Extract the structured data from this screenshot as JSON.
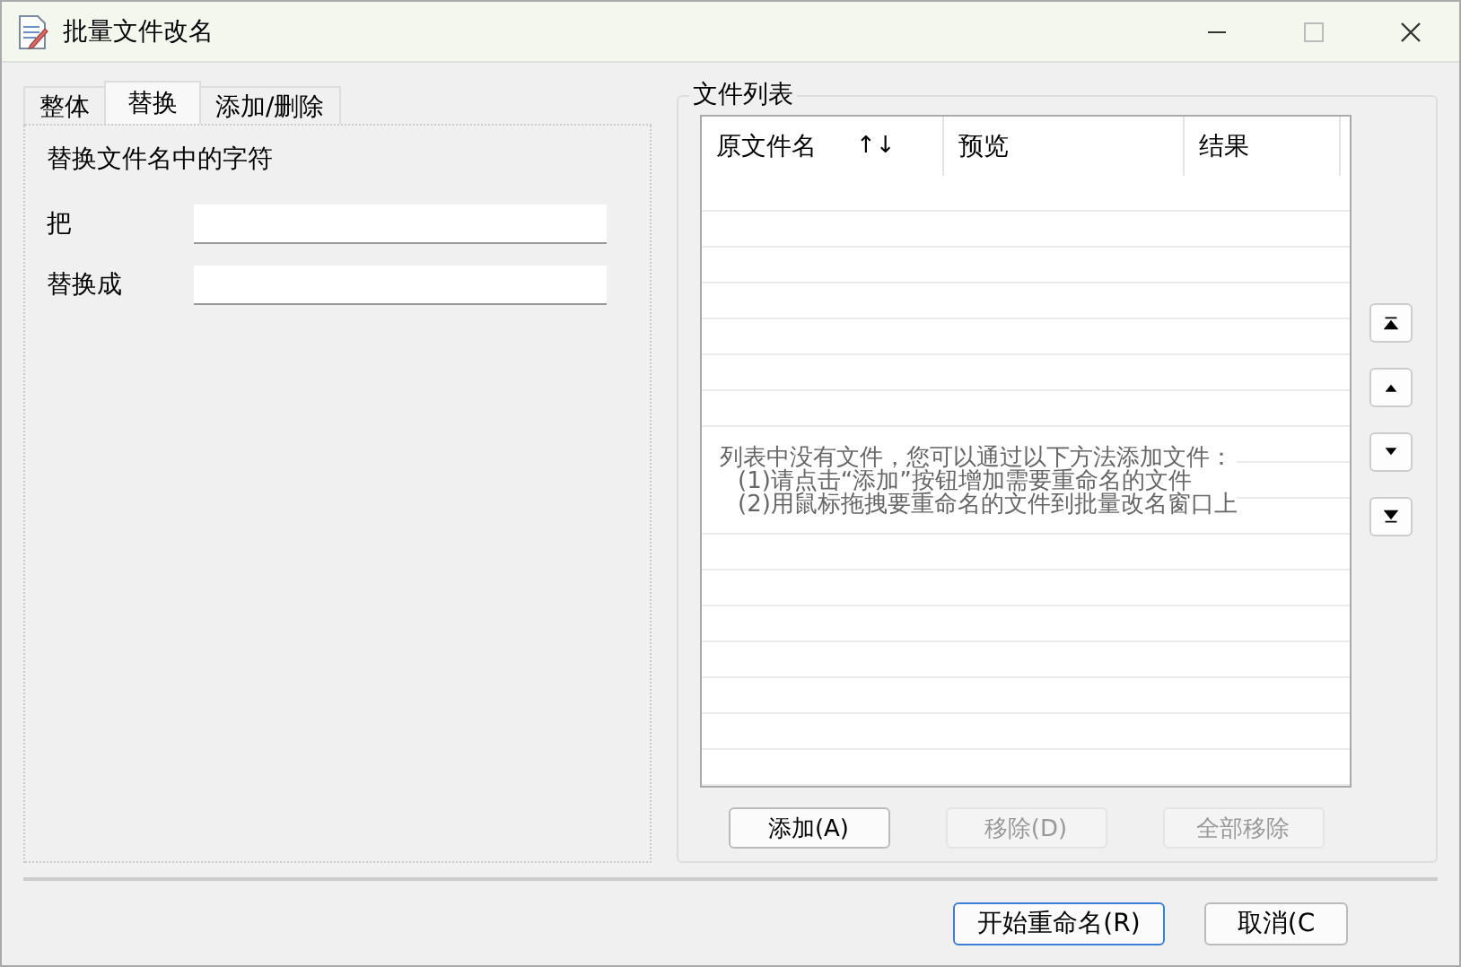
{
  "window": {
    "title": "批量文件改名",
    "maximize_disabled": true
  },
  "tabs": [
    {
      "label": "整体",
      "selected": false
    },
    {
      "label": "替换",
      "selected": true
    },
    {
      "label": "添加/删除",
      "selected": false
    }
  ],
  "replace_panel": {
    "heading": "替换文件名中的字符",
    "fields": [
      {
        "label": "把"
      },
      {
        "label": "替换成"
      }
    ]
  },
  "file_list": {
    "title": "文件列表",
    "columns": [
      {
        "label": "原文件名",
        "sort": "↑↓"
      },
      {
        "label": "预览"
      },
      {
        "label": "结果"
      }
    ],
    "empty_message": [
      "列表中没有文件，您可以通过以下方法添加文件：",
      "(1)请点击“添加”按钮增加需要重命名的文件",
      "(2)用鼠标拖拽要重命名的文件到批量改名窗口上"
    ]
  },
  "move_buttons": [
    {
      "kind": "top"
    },
    {
      "kind": "up"
    },
    {
      "kind": "down"
    },
    {
      "kind": "bottom"
    }
  ],
  "list_buttons": [
    {
      "label": "添加(A)",
      "disabled": false
    },
    {
      "label": "移除(D)",
      "disabled": true
    },
    {
      "label": "全部移除",
      "disabled": true
    }
  ],
  "footer_buttons": [
    {
      "label": "开始重命名(R)",
      "focused": true
    },
    {
      "label": "取消(C",
      "focused": false
    }
  ]
}
